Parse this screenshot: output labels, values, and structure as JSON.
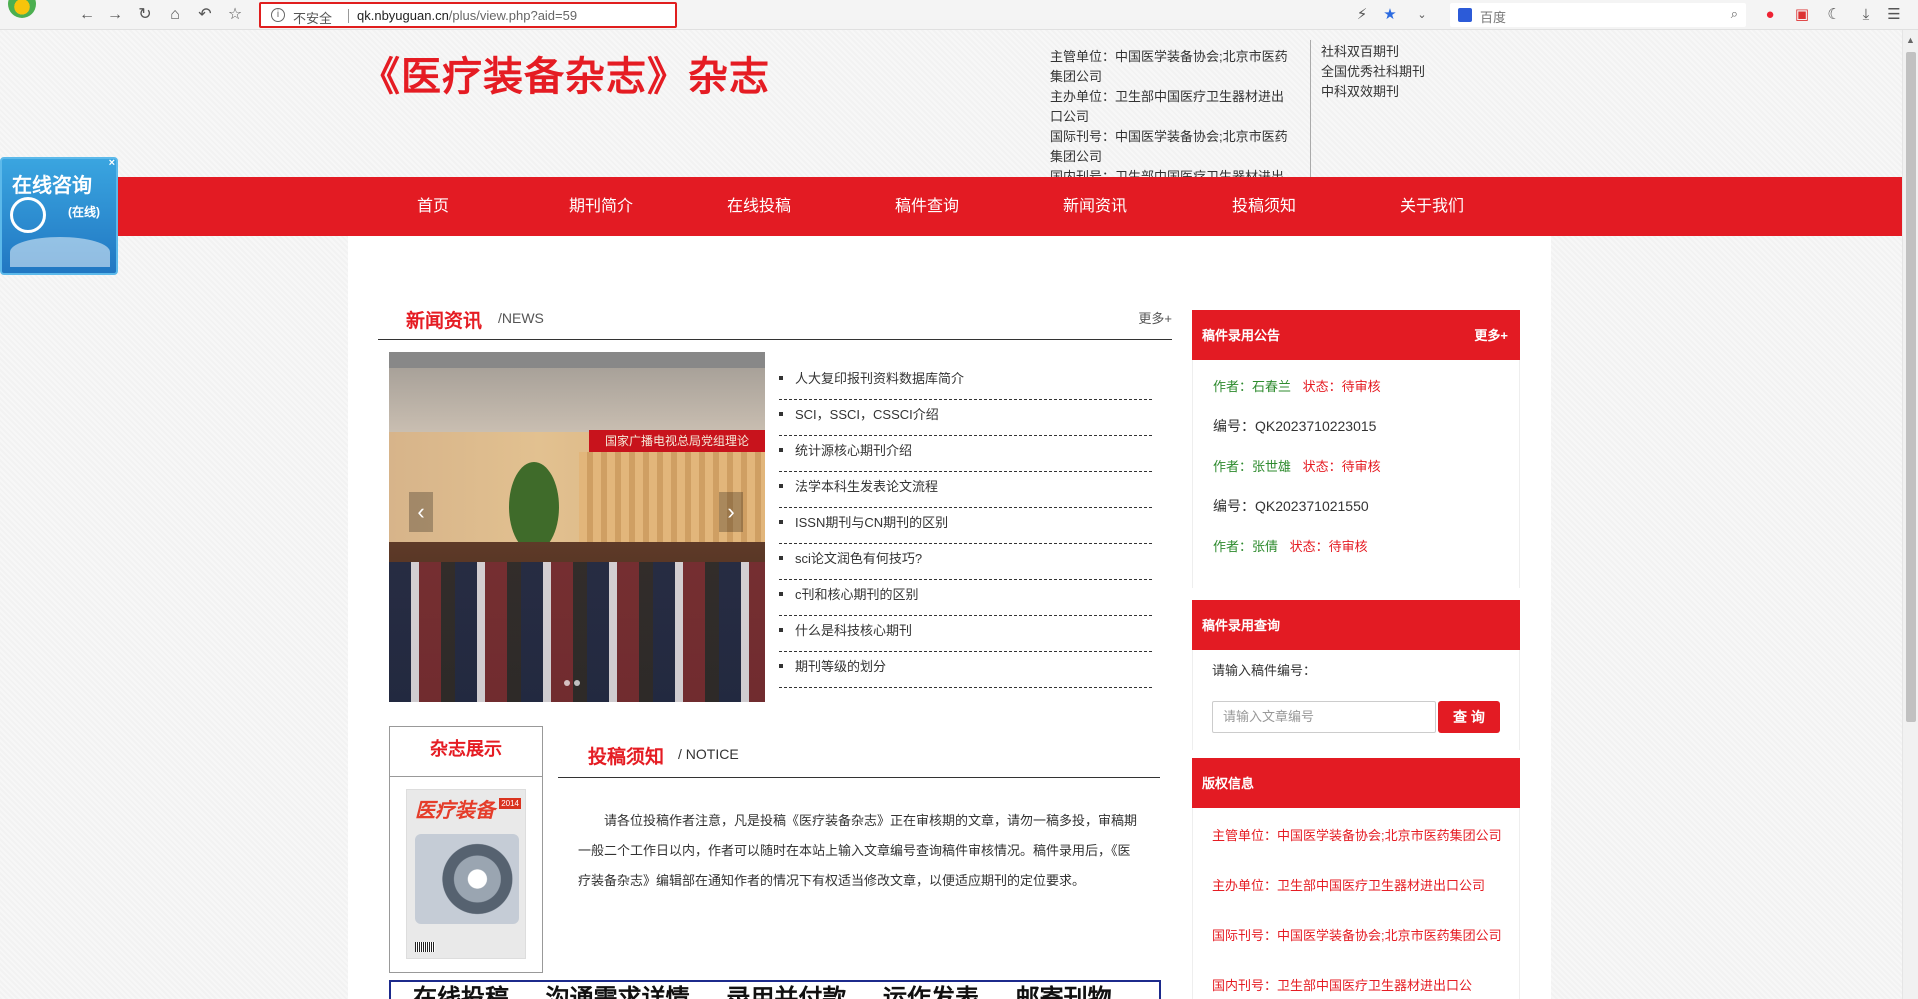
{
  "browser": {
    "insecure_label": "不安全",
    "url_domain": "qk.nbyuguan.cn",
    "url_path": "/plus/view.php?aid=59",
    "search_placeholder": "百度"
  },
  "header": {
    "title": "《医疗装备杂志》杂志",
    "info_lines": [
      "主管单位：中国医学装备协会;北京市医药",
      "集团公司",
      "主办单位：卫生部中国医疗卫生器材进出",
      "口公司",
      "国际刊号：中国医学装备协会;北京市医药",
      "集团公司",
      "国内刊号：卫生部中国医疗卫生器材进出"
    ],
    "tags": [
      "社科双百期刊",
      "全国优秀社科期刊",
      "中科双效期刊"
    ]
  },
  "nav": [
    "首页",
    "期刊简介",
    "在线投稿",
    "稿件查询",
    "新闻资讯",
    "投稿须知",
    "关于我们"
  ],
  "consult": {
    "title": "在线咨询",
    "status": "(在线)",
    "close": "×"
  },
  "news": {
    "title": "新闻资讯",
    "subtitle": "/NEWS",
    "more": "更多+",
    "banner_text": "国家广播电视总局党组理论",
    "items": [
      "人大复印报刊资料数据库简介",
      "SCI，SSCI，CSSCI介绍",
      "统计源核心期刊介绍",
      "法学本科生发表论文流程",
      "ISSN期刊与CN期刊的区别",
      "sci论文润色有何技巧?",
      "c刊和核心期刊的区别",
      "什么是科技核心期刊",
      "期刊等级的划分"
    ]
  },
  "magazine": {
    "title": "杂志展示",
    "cover_title": "医疗装备",
    "cover_year": "2014"
  },
  "notice": {
    "title": "投稿须知",
    "subtitle": "/ NOTICE",
    "body": "请各位投稿作者注意，凡是投稿《医疗装备杂志》正在审核期的文章，请勿一稿多投，审稿期一般二个工作日以内，作者可以随时在本站上输入文章编号查询稿件审核情况。稿件录用后，《医疗装备杂志》编辑部在通知作者的情况下有权适当修改文章，以便适应期刊的定位要求。"
  },
  "bottom_strip": "在线投稿 沟通需求详情 录用并付款 运作发表 邮寄刊物",
  "records": {
    "title": "稿件录用公告",
    "more": "更多+",
    "author_label": "作者：",
    "status_label": "状态：",
    "code_label": "编号：",
    "rows": [
      {
        "author": "石春兰",
        "status": "待审核",
        "code": "QK2023710223015"
      },
      {
        "author": "张世雄",
        "status": "待审核",
        "code": "QK202371021550"
      },
      {
        "author": "张倩",
        "status": "待审核"
      }
    ]
  },
  "query": {
    "title": "稿件录用查询",
    "label": "请输入稿件编号：",
    "placeholder": "请输入文章编号",
    "button": "查 询"
  },
  "copyright": {
    "title": "版权信息",
    "lines": [
      "主管单位：中国医学装备协会;北京市医药集团公司",
      "主办单位：卫生部中国医疗卫生器材进出口公司",
      "国际刊号：中国医学装备协会;北京市医药集团公司",
      "国内刊号：卫生部中国医疗卫生器材进出口公"
    ]
  },
  "colors": {
    "accent": "#e31b23",
    "green": "#2e8b2e"
  }
}
